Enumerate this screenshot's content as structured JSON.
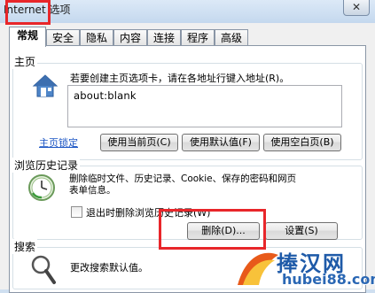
{
  "window": {
    "title": "Internet 选项",
    "close_icon": "close-icon"
  },
  "tabs": [
    {
      "label": "常规",
      "active": true
    },
    {
      "label": "安全"
    },
    {
      "label": "隐私"
    },
    {
      "label": "内容"
    },
    {
      "label": "连接"
    },
    {
      "label": "程序"
    },
    {
      "label": "高级"
    }
  ],
  "homepage": {
    "group_title": "主页",
    "message": "若要创建主页选项卡，请在各地址行键入地址(R)。",
    "address_value": "about:blank",
    "lock_link": "主页锁定",
    "btn_current": "使用当前页(C)",
    "btn_default": "使用默认值(F)",
    "btn_blank": "使用空白页(B)"
  },
  "history": {
    "group_title": "浏览历史记录",
    "message_line1": "删除临时文件、历史记录、Cookie、保存的密码和网页",
    "message_line2": "表单信息。",
    "checkbox_label": "退出时删除浏览历史记录(W)",
    "checkbox_checked": false,
    "btn_delete": "删除(D)...",
    "btn_settings": "设置(S)"
  },
  "search": {
    "group_title": "搜索",
    "message": "更改搜索默认值。"
  },
  "watermark": {
    "brand": "捧汉网",
    "url": "hubei88.com"
  },
  "colors": {
    "highlight": "#e8262a",
    "link": "#1a54c4"
  }
}
